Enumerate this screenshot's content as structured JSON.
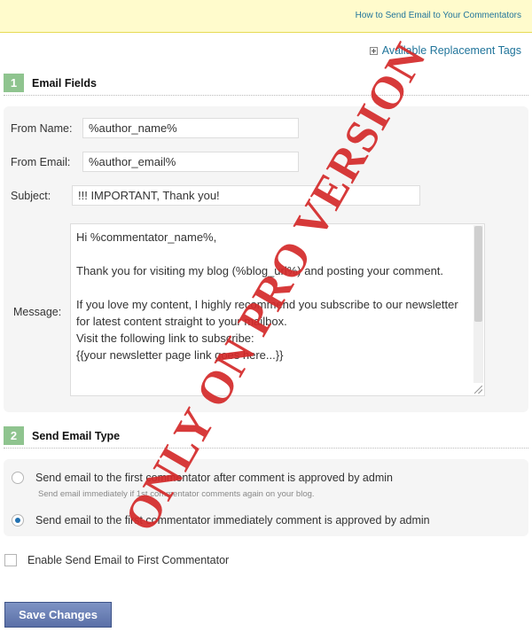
{
  "notice": {
    "link_text": "How to Send Email to Your Commentators"
  },
  "replacement_tags": {
    "label": "Available Replacement Tags"
  },
  "section1": {
    "number": "1",
    "title": "Email Fields",
    "from_name": {
      "label": "From Name:",
      "value": "%author_name%"
    },
    "from_email": {
      "label": "From Email:",
      "value": "%author_email%"
    },
    "subject": {
      "label": "Subject:",
      "value": "!!! IMPORTANT, Thank you!"
    },
    "message": {
      "label": "Message:",
      "value": "Hi %commentator_name%,\n\nThank you for visiting my blog (%blog_url%) and posting your comment.\n\nIf you love my content, I highly recommend you subscribe to our newsletter for latest content straight to your mailbox.\nVisit the following link to subscribe:\n{{your newsletter page link goes here...}}"
    }
  },
  "section2": {
    "number": "2",
    "title": "Send Email Type",
    "options": [
      {
        "label": "Send email to the first commentator after comment is approved by admin",
        "sublabel": "Send email immediately if 1st commentator comments again on your blog.",
        "checked": false
      },
      {
        "label": "Send email to the first commentator immediately comment is approved by admin",
        "checked": true
      }
    ]
  },
  "enable_checkbox": {
    "label": "Enable Send Email to First Commentator",
    "checked": false
  },
  "save_button": {
    "label": "Save Changes"
  },
  "watermark": {
    "text": "ONLY ON PRO VERSION",
    "color": "#d42a2a"
  },
  "colors": {
    "link": "#21759b",
    "section_number_bg": "#8fc48f",
    "notice_bg": "#fffbcc",
    "button_bg": "#6a7fb5"
  }
}
